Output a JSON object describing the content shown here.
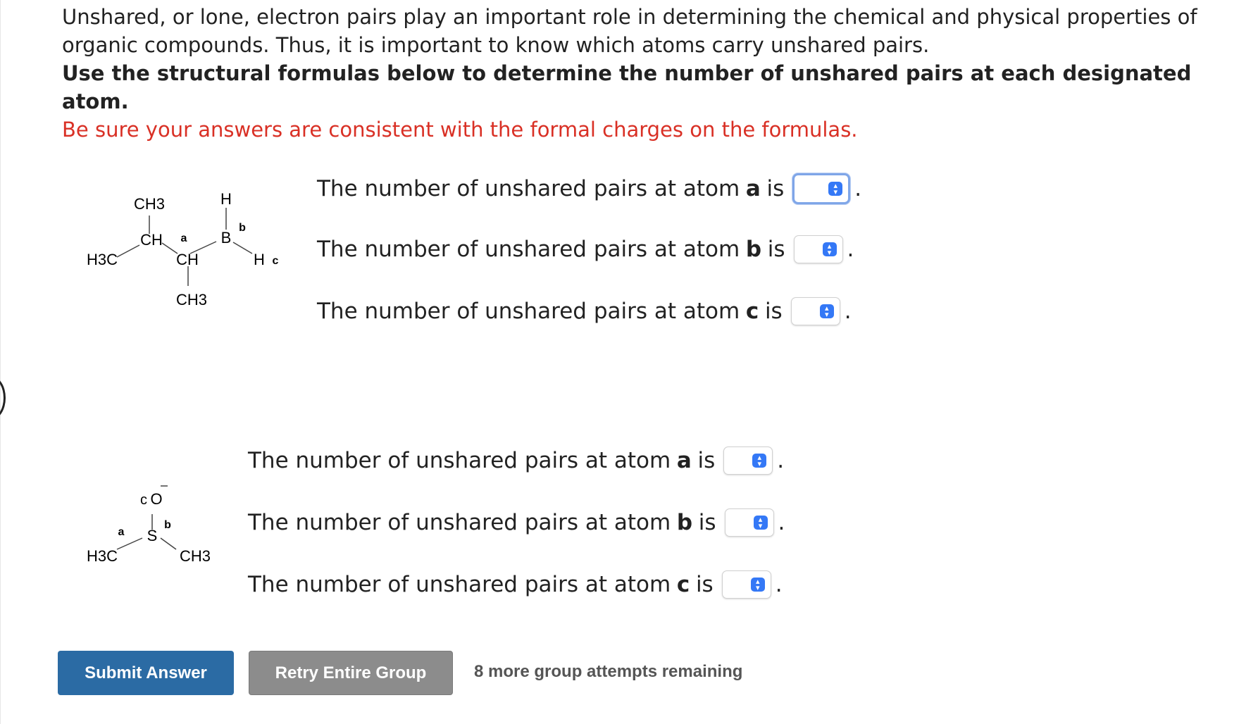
{
  "intro": {
    "line1": "Unshared, or lone, electron pairs play an important role in determining the chemical and physical properties of organic compounds. Thus, it is important to know which atoms carry unshared pairs.",
    "line2": "Use the structural formulas below to determine the number of unshared pairs at each designated atom.",
    "line3": "Be sure your answers are consistent with the formal charges on the formulas."
  },
  "molecule1": {
    "ch3_top": "CH3",
    "h_top": "H",
    "ch": "CH",
    "label_a": "a",
    "b_atom": "B",
    "label_b": "b",
    "h3c": "H3C",
    "ch_mid": "CH",
    "h_right": "H",
    "label_c": "c",
    "ch3_bottom": "CH3"
  },
  "molecule2": {
    "label_c": "c",
    "o_atom": "O",
    "label_b": "b",
    "label_a": "a",
    "s_atom": "S",
    "h3c": "H3C",
    "ch3": "CH3"
  },
  "questions1": [
    {
      "prefix": "The number of unshared pairs at atom",
      "atom": "a",
      "suffix": "is",
      "value": ""
    },
    {
      "prefix": "The number of unshared pairs at atom",
      "atom": "b",
      "suffix": "is",
      "value": ""
    },
    {
      "prefix": "The number of unshared pairs at atom",
      "atom": "c",
      "suffix": "is",
      "value": ""
    }
  ],
  "questions2": [
    {
      "prefix": "The number of unshared pairs at atom",
      "atom": "a",
      "suffix": "is",
      "value": ""
    },
    {
      "prefix": "The number of unshared pairs at atom",
      "atom": "b",
      "suffix": "is",
      "value": ""
    },
    {
      "prefix": "The number of unshared pairs at atom",
      "atom": "c",
      "suffix": "is",
      "value": ""
    }
  ],
  "punct": ".",
  "buttons": {
    "submit": "Submit Answer",
    "retry": "Retry Entire Group"
  },
  "attempts": "8 more group attempts remaining",
  "colors": {
    "submit": "#2b6ba4",
    "retry": "#8c8c8c",
    "warning": "#d93025",
    "select_chevron": "#3478f6"
  }
}
